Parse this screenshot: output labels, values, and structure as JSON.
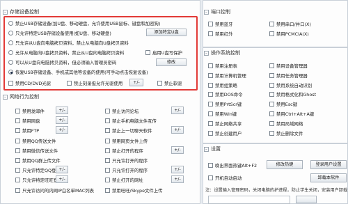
{
  "storage": {
    "title": "存储设备控制",
    "options": [
      {
        "label": "禁止USB存储设备(加U盘、移动硬盘，允许使用USB鼠标、键盘和加密狗)",
        "selected": false
      },
      {
        "label": "只允许特定USB存储设备使用(如U盘、移动硬盘)",
        "selected": false
      },
      {
        "label": "只允许从U盘向电脑拷贝资料，禁止从电脑向U盘拷贝资料",
        "selected": false
      },
      {
        "label": "允许从电脑向U盘拷贝资料，禁止从U盘向电脑拷贝资料",
        "selected": false
      },
      {
        "label": "可以从U盘向电脑拷贝资料，但必须输入管理员密码",
        "selected": false
      },
      {
        "label": "恢复USB存储设备、手机或其他等设备的使用(可手动点击恢复设备)",
        "selected": true
      }
    ],
    "add_usb_btn": "添加特定U盘",
    "u_write_protect": "启用U盘写保护",
    "modify_btn": "修改",
    "disable_cd": "禁用CD/DVD光驱",
    "disable_burn": "禁止刻录但允许光驱使用",
    "plus_btn": "+/-",
    "disable_floppy": "禁止软驱"
  },
  "network": {
    "title": "网络行为控制",
    "left": [
      "禁用发邮件",
      "禁用网盘",
      "禁用FTP",
      "禁用QQ传送文件",
      "禁用微信传送文件",
      "禁用QQ群上传文件",
      "只允许特定QQ登录",
      "只允许特定旺旺登录",
      "只允许访问的内网IP白名单MAC列表"
    ],
    "right": [
      "禁止访问论坛",
      "禁止手机电脑文件互传",
      "禁止上一切聊天软件",
      "禁用网页文件上传",
      "禁止打开的程序",
      "只允许打开的程序",
      "只允许打开的程序",
      "禁止打开的网址",
      "禁用旺旺/Skype文件上传"
    ],
    "plus_btn": "+/-"
  },
  "ports": {
    "title": "端口控制",
    "left": [
      "禁用蓝牙",
      "禁用红外"
    ],
    "right": [
      "禁用串口/并口(X)",
      "禁用PCMCIA(X)"
    ]
  },
  "os": {
    "title": "操作系统控制",
    "left": [
      "禁用注册表",
      "禁用计算机管理",
      "禁用组策略",
      "禁用DOS命令",
      "禁用PrtScr键",
      "禁用Win键",
      "禁止网络共享",
      "禁止创建用户"
    ],
    "right": [
      "禁用设备管理器",
      "禁用任务管理器",
      "禁用系统自动识别",
      "禁用格式化和Ghost",
      "禁用Esc键",
      "禁用Ctrl+Alt+A键",
      "禁用局域网络",
      "禁止删除文件"
    ]
  },
  "settings": {
    "title": "设置",
    "hotkey_label": "唤出界面热键Alt+F2",
    "modify_hotkey_btn": "修改热键",
    "login_log_btn": "登录用户设置",
    "autostart": "开机自动启动",
    "uninstall_btn": "卸载本软件",
    "note": "注：设置输入管理密码，关闭电脑的护进程，防止学生关闭，安装用户卸载"
  }
}
